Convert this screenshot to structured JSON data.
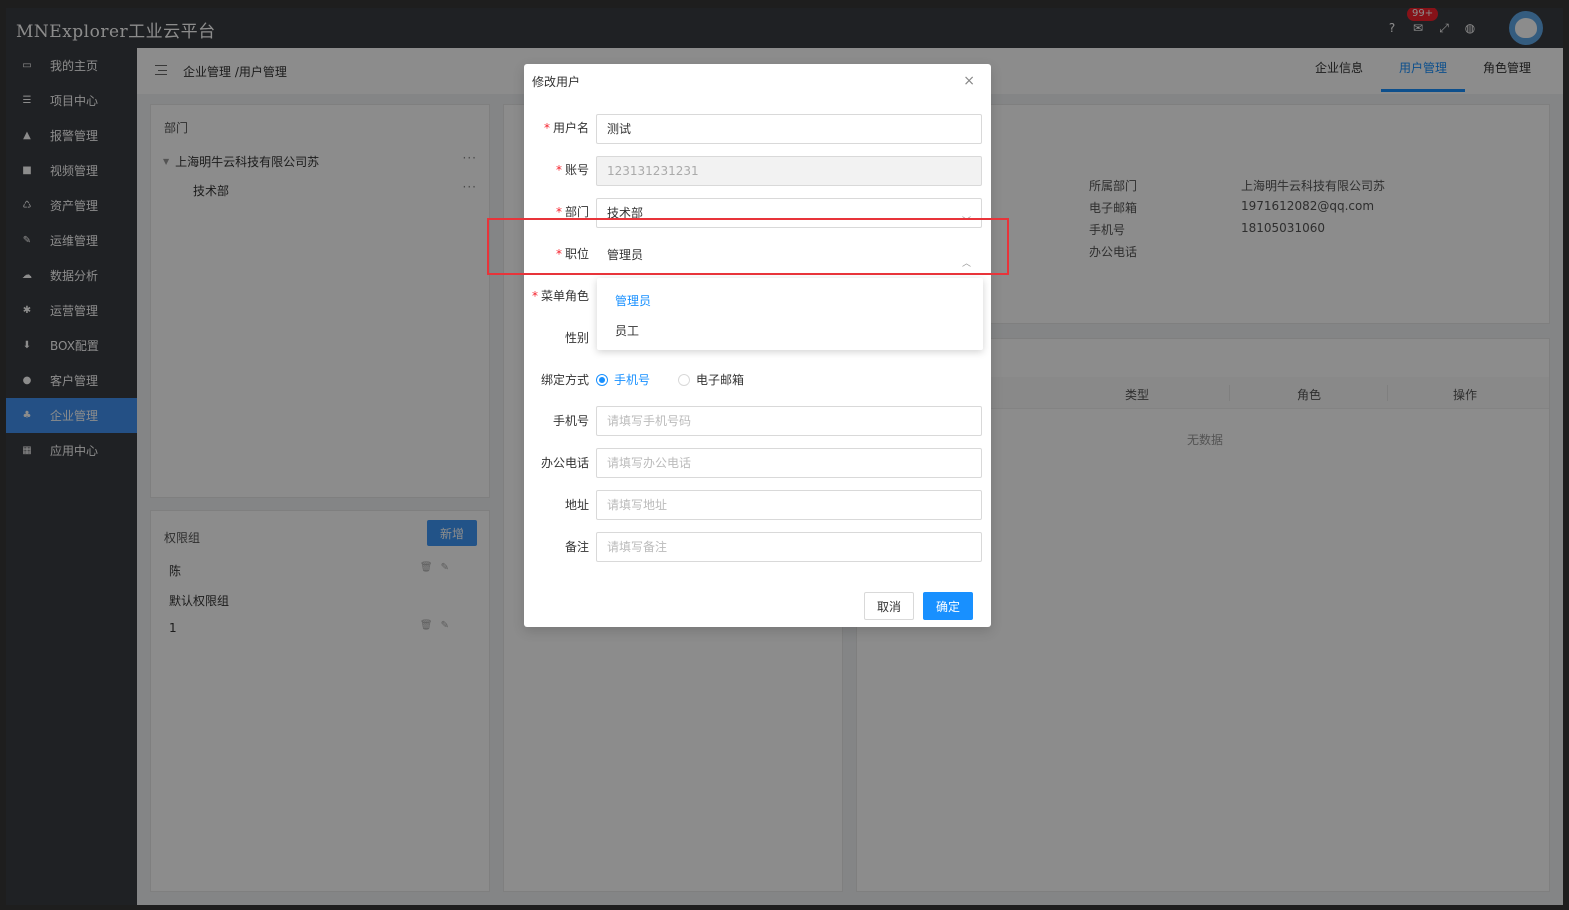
{
  "app": {
    "title": "MNExplorer工业云平台",
    "notification_badge": "99+"
  },
  "sidebar": {
    "items": [
      {
        "label": "我的主页",
        "icon": "laptop-icon"
      },
      {
        "label": "项目中心",
        "icon": "list-icon"
      },
      {
        "label": "报警管理",
        "icon": "bell-icon"
      },
      {
        "label": "视频管理",
        "icon": "video-icon"
      },
      {
        "label": "资产管理",
        "icon": "recycle-icon"
      },
      {
        "label": "运维管理",
        "icon": "wrench-icon"
      },
      {
        "label": "数据分析",
        "icon": "cloud-icon"
      },
      {
        "label": "运营管理",
        "icon": "network-icon"
      },
      {
        "label": "BOX配置",
        "icon": "download-icon"
      },
      {
        "label": "客户管理",
        "icon": "users-icon"
      },
      {
        "label": "企业管理",
        "icon": "sitemap-icon",
        "active": true
      },
      {
        "label": "应用中心",
        "icon": "grid-icon"
      }
    ]
  },
  "breadcrumb": "企业管理 /用户管理",
  "tabs": [
    "企业信息",
    "用户管理",
    "角色管理"
  ],
  "dept_panel": {
    "title": "部门",
    "tree": [
      {
        "label": "上海明牛云科技有限公司苏",
        "more": "···"
      },
      {
        "label": "技术部",
        "more": "···"
      }
    ]
  },
  "perm_panel": {
    "title": "权限组",
    "add_label": "新增",
    "rows": [
      "陈",
      "默认权限组",
      "1"
    ]
  },
  "user_info": {
    "labels": [
      "所属部门",
      "电子邮箱",
      "手机号",
      "办公电话"
    ],
    "values": [
      "上海明牛云科技有限公司苏",
      "1971612082@qq.com",
      "18105031060",
      ""
    ]
  },
  "user_table": {
    "columns": [
      "类型",
      "角色",
      "操作"
    ],
    "empty": "无数据"
  },
  "modal": {
    "title": "修改用户",
    "close": "×",
    "fields": {
      "username": {
        "label": "用户名",
        "value": "测试"
      },
      "account": {
        "label": "账号",
        "value": "123131231231"
      },
      "dept": {
        "label": "部门",
        "value": "技术部"
      },
      "position": {
        "label": "职位",
        "value": "管理员"
      },
      "menu_role": {
        "label": "菜单角色"
      },
      "gender": {
        "label": "性别"
      },
      "bind": {
        "label": "绑定方式",
        "options": [
          "手机号",
          "电子邮箱"
        ],
        "selected": "手机号"
      },
      "phone": {
        "label": "手机号",
        "placeholder": "请填写手机号码"
      },
      "office": {
        "label": "办公电话",
        "placeholder": "请填写办公电话"
      },
      "address": {
        "label": "地址",
        "placeholder": "请填写地址"
      },
      "remark": {
        "label": "备注",
        "placeholder": "请填写备注"
      }
    },
    "position_options": [
      "管理员",
      "员工"
    ],
    "cancel": "取消",
    "ok": "确定"
  },
  "colors": {
    "accent": "#1890ff",
    "sidebar": "#3a3d42",
    "highlight": "#e8343a"
  }
}
